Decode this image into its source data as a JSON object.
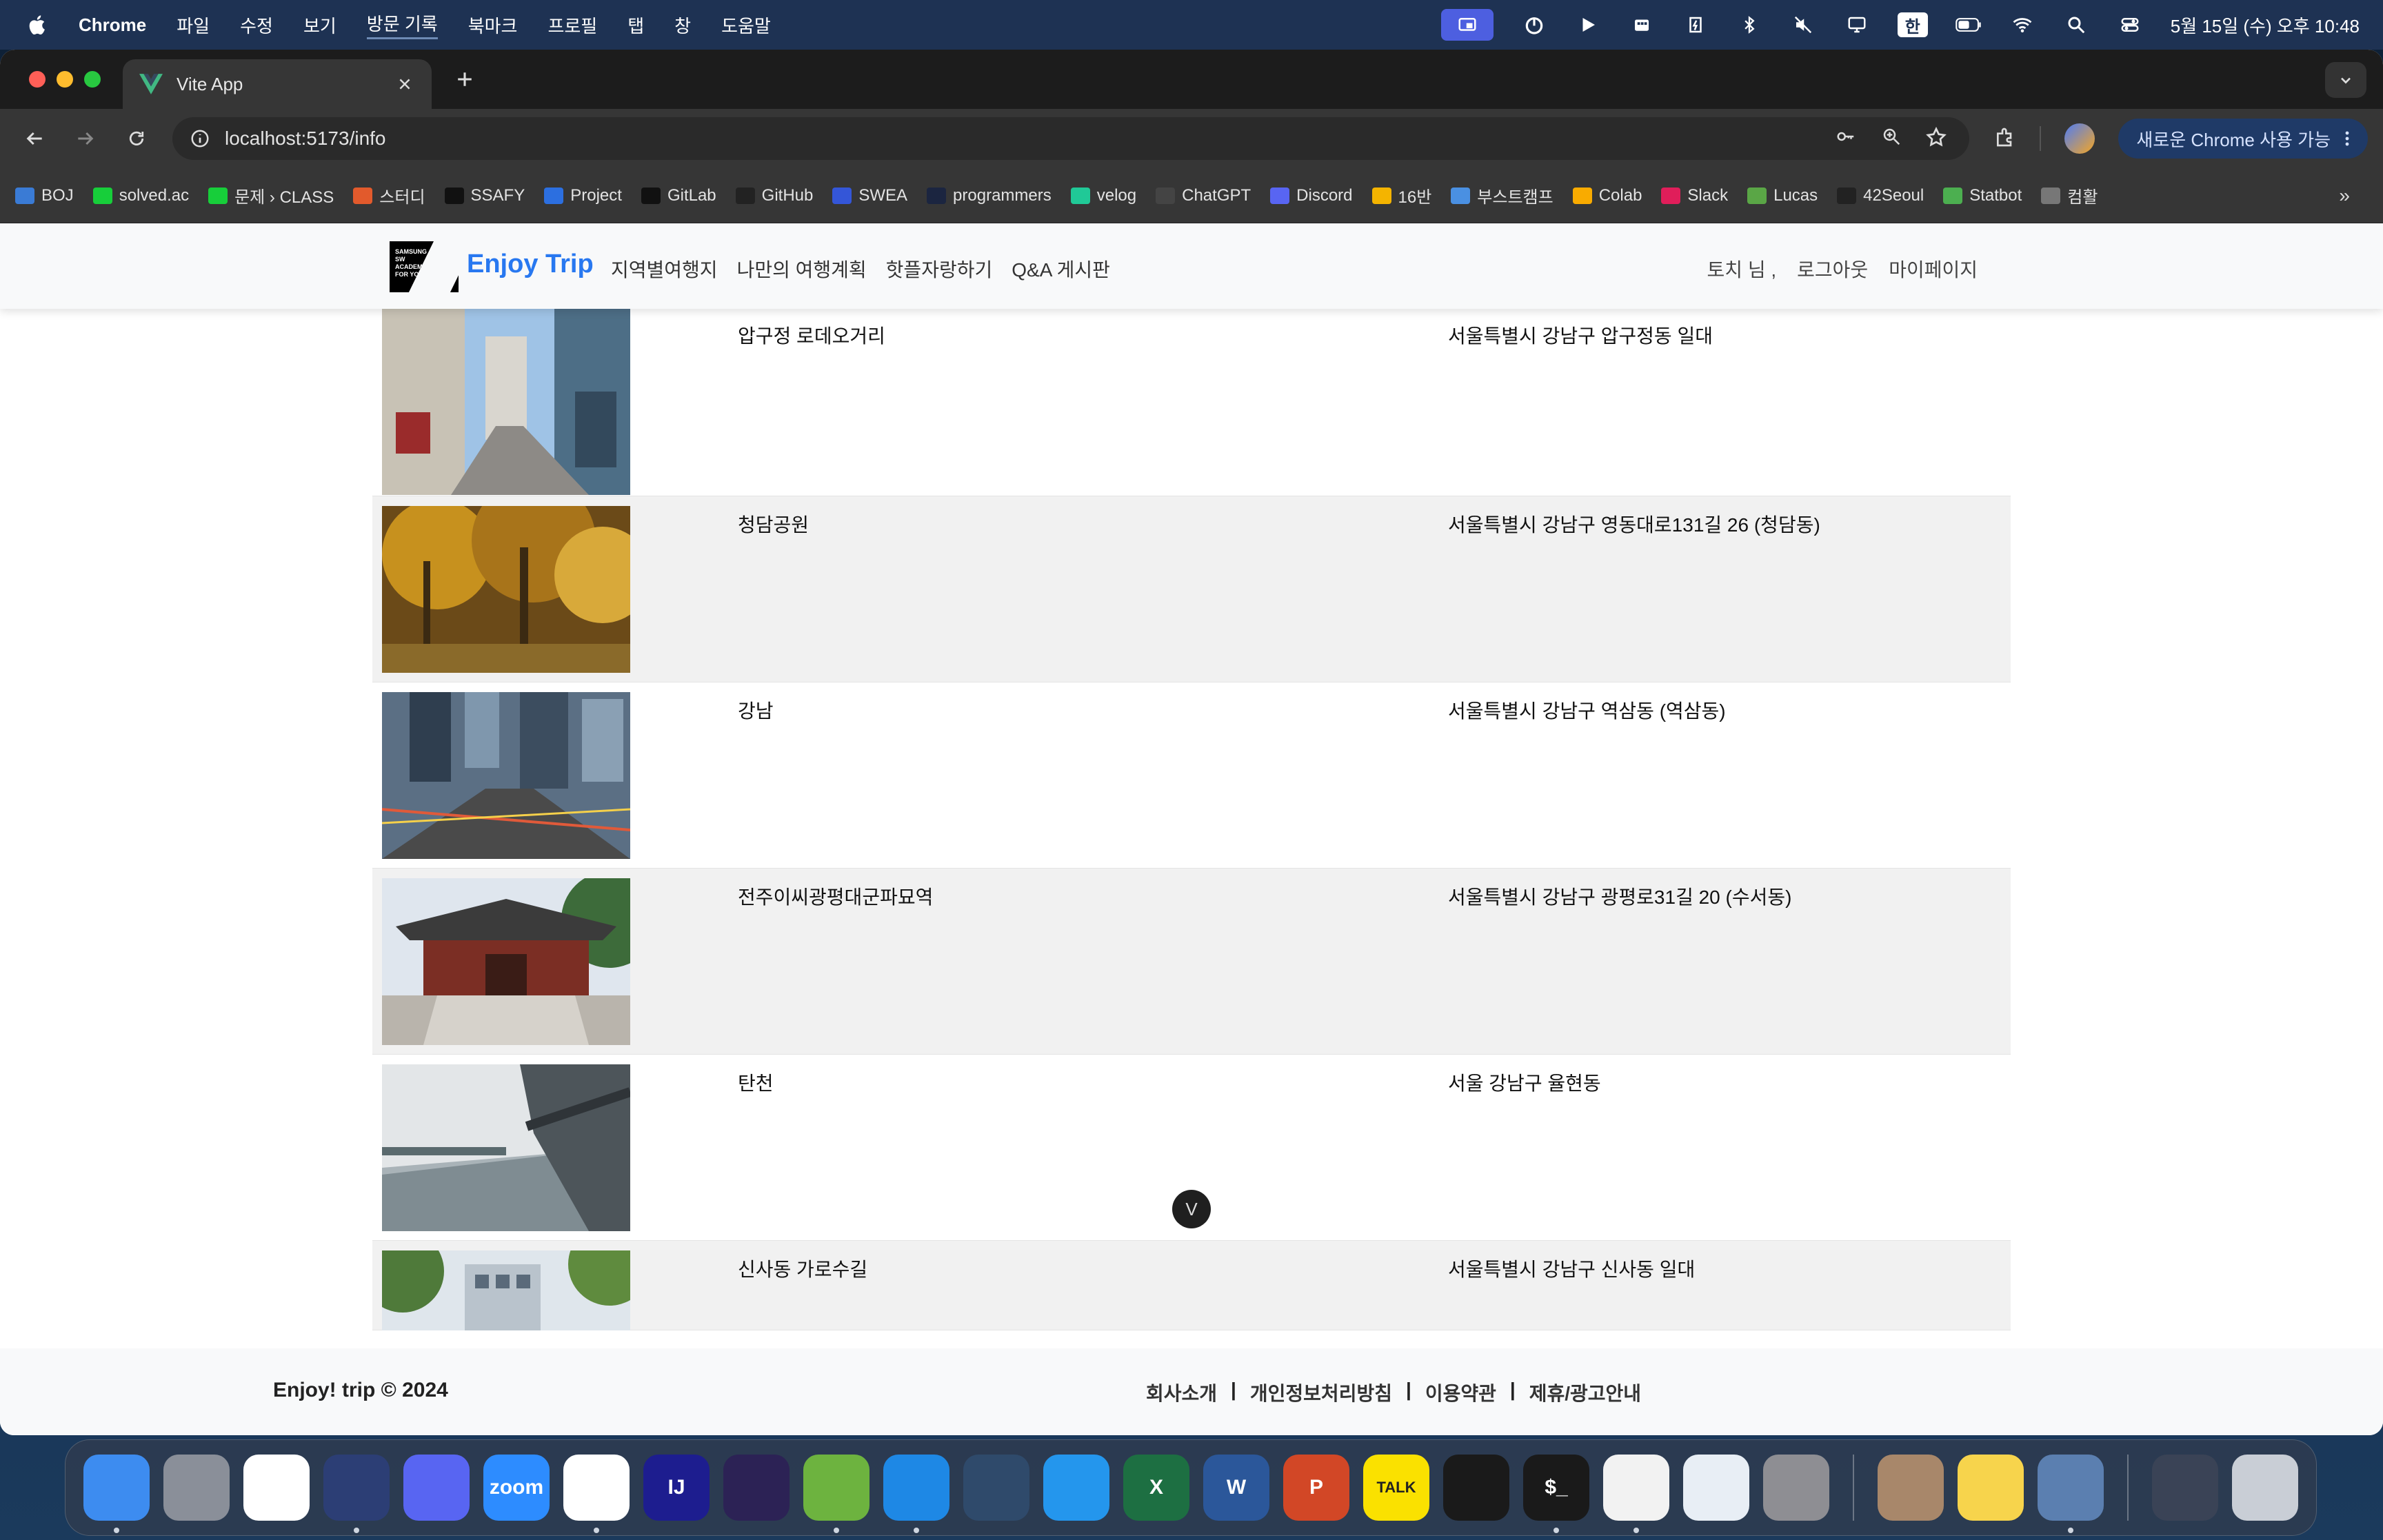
{
  "menubar": {
    "app": "Chrome",
    "menus": [
      "파일",
      "수정",
      "보기",
      "방문 기록",
      "북마크",
      "프로필",
      "탭",
      "창",
      "도움말"
    ],
    "input_source": "한",
    "clock": "5월 15일 (수) 오후 10:48"
  },
  "browser": {
    "tab_title": "Vite App",
    "url": "localhost:5173/info",
    "update_button": "새로운 Chrome 사용 가능",
    "bookmarks": [
      {
        "label": "BOJ",
        "icon": "code-icon",
        "color": "#3a7bd5"
      },
      {
        "label": "solved.ac",
        "icon": "solvedac-icon",
        "color": "#17ce3a"
      },
      {
        "label": "문제 › CLASS",
        "icon": "solvedac-icon",
        "color": "#17ce3a"
      },
      {
        "label": "스터디",
        "icon": "diamond-icon",
        "color": "#e25a2c"
      },
      {
        "label": "SSAFY",
        "icon": "notion-icon",
        "color": "#111111"
      },
      {
        "label": "Project",
        "icon": "confluence-icon",
        "color": "#2c6fe0"
      },
      {
        "label": "GitLab",
        "icon": "notion-icon",
        "color": "#111111"
      },
      {
        "label": "GitHub",
        "icon": "github-icon",
        "color": "#222222"
      },
      {
        "label": "SWEA",
        "icon": "swea-icon",
        "color": "#3456d8"
      },
      {
        "label": "programmers",
        "icon": "programmers-icon",
        "color": "#1b2540"
      },
      {
        "label": "velog",
        "icon": "velog-icon",
        "color": "#20c997"
      },
      {
        "label": "ChatGPT",
        "icon": "chatgpt-icon",
        "color": "#444444"
      },
      {
        "label": "Discord",
        "icon": "discord-icon",
        "color": "#5865f2"
      },
      {
        "label": "16반",
        "icon": "drive-icon",
        "color": "#f4b400"
      },
      {
        "label": "부스트캠프",
        "icon": "boostcamp-icon",
        "color": "#4a90e2"
      },
      {
        "label": "Colab",
        "icon": "colab-icon",
        "color": "#f9ab00"
      },
      {
        "label": "Slack",
        "icon": "slack-icon",
        "color": "#e01e5a"
      },
      {
        "label": "Lucas",
        "icon": "lucas-icon",
        "color": "#5aa646"
      },
      {
        "label": "42Seoul",
        "icon": "42-icon",
        "color": "#222222"
      },
      {
        "label": "Statbot",
        "icon": "statbot-icon",
        "color": "#4caf50"
      },
      {
        "label": "컴활",
        "icon": "globe-icon",
        "color": "#777777"
      }
    ]
  },
  "site": {
    "brand": "Enjoy Trip",
    "logo_text": "SAMSUNG SW ACADEMY FOR YOUTH",
    "nav": [
      "지역별여행지",
      "나만의 여행계획",
      "핫플자랑하기",
      "Q&A 게시판"
    ],
    "user_links": [
      "토치 님 ,",
      "로그아웃",
      "마이페이지"
    ],
    "places": [
      {
        "name": "압구정 로데오거리",
        "address": "서울특별시 강남구 압구정동 일대",
        "image": "street-photo"
      },
      {
        "name": "청담공원",
        "address": "서울특별시 강남구 영동대로131길 26 (청담동)",
        "image": "autumn-park-photo"
      },
      {
        "name": "강남",
        "address": "서울특별시 강남구 역삼동 (역삼동)",
        "image": "city-intersection-photo"
      },
      {
        "name": "전주이씨광평대군파묘역",
        "address": "서울특별시 강남구 광평로31길 20 (수서동)",
        "image": "korean-gate-photo"
      },
      {
        "name": "탄천",
        "address": "서울 강남구 율현동",
        "image": "river-bridge-photo"
      },
      {
        "name": "신사동 가로수길",
        "address": "서울특별시 강남구 신사동 일대",
        "image": "tree-street-photo"
      }
    ],
    "footer": {
      "copyright": "Enjoy! trip © 2024",
      "links": [
        "회사소개",
        "개인정보처리방침",
        "이용약관",
        "제휴/광고안내"
      ],
      "separator": "|",
      "scroll_symbol": "V"
    }
  },
  "dock": {
    "apps": [
      {
        "name": "finder",
        "color": "#3d8cf0"
      },
      {
        "name": "launchpad",
        "color": "#8a8f99"
      },
      {
        "name": "slack",
        "color": "#ffffff"
      },
      {
        "name": "clock",
        "color": "#2c3e75"
      },
      {
        "name": "discord",
        "color": "#5865f2"
      },
      {
        "name": "zoom",
        "color": "#2d8cff",
        "label": "zoom"
      },
      {
        "name": "chrome",
        "color": "#ffffff"
      },
      {
        "name": "intellij",
        "color": "#1d1d8f",
        "label": "IJ"
      },
      {
        "name": "eclipse",
        "color": "#2c2255"
      },
      {
        "name": "spring",
        "color": "#6db33f"
      },
      {
        "name": "vscode",
        "color": "#1e88e5"
      },
      {
        "name": "mysql-workbench",
        "color": "#2f4a6b"
      },
      {
        "name": "docker",
        "color": "#2496ed"
      },
      {
        "name": "excel",
        "color": "#1d6f42",
        "label": "X"
      },
      {
        "name": "word",
        "color": "#2b579a",
        "label": "W"
      },
      {
        "name": "powerpoint",
        "color": "#d24726",
        "label": "P"
      },
      {
        "name": "kakaotalk",
        "color": "#fae100",
        "label": "TALK"
      },
      {
        "name": "activity-monitor",
        "color": "#1a1a1a"
      },
      {
        "name": "terminal",
        "color": "#1a1a1a",
        "label": "$_"
      },
      {
        "name": "textedit",
        "color": "#f2f2f2"
      },
      {
        "name": "script-editor",
        "color": "#e8eef5"
      },
      {
        "name": "system-settings",
        "color": "#8e8e93"
      },
      {
        "name": "preview-photo",
        "color": "#a8876a"
      },
      {
        "name": "notes",
        "color": "#f7d44c"
      },
      {
        "name": "preview",
        "color": "#5b7fb0"
      },
      {
        "name": "downloads",
        "color": "#3a4356"
      },
      {
        "name": "trash",
        "color": "#c9ced6"
      }
    ]
  },
  "colors": {
    "brand": "#2878f0",
    "header_bg": "#f8f9fa",
    "row_alt": "#f1f1f1"
  }
}
